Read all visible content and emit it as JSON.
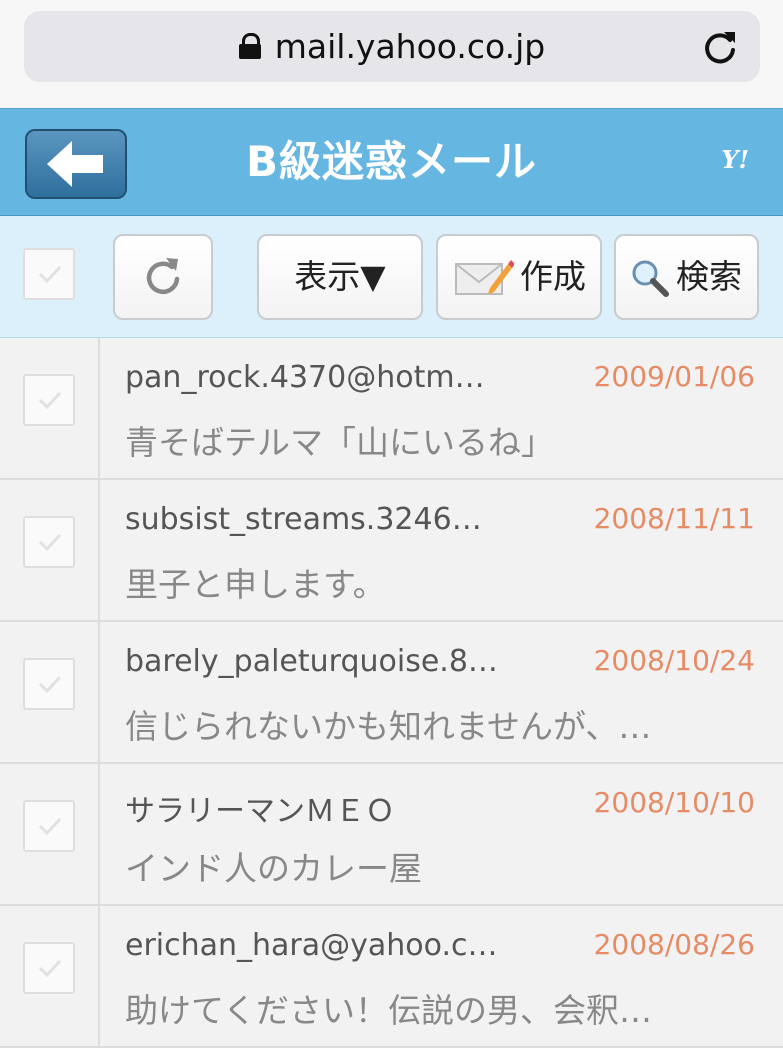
{
  "browser": {
    "url": "mail.yahoo.co.jp"
  },
  "header": {
    "title": "B級迷惑メール",
    "logo": "Y!"
  },
  "toolbar": {
    "display_label": "表示▼",
    "compose_label": "作成",
    "search_label": "検索"
  },
  "colors": {
    "header_bg": "#66b6e2",
    "toolbar_bg": "#dcf0fb",
    "date_color": "#e58c66"
  },
  "messages": [
    {
      "sender": "pan_rock.4370@hotm…",
      "date": "2009/01/06",
      "subject": "青そばテルマ「山にいるね」"
    },
    {
      "sender": "subsist_streams.3246…",
      "date": "2008/11/11",
      "subject": "里子と申します。"
    },
    {
      "sender": "barely_paleturquoise.8…",
      "date": "2008/10/24",
      "subject": "信じられないかも知れませんが、…"
    },
    {
      "sender": "サラリーマンＭＥＯ",
      "date": "2008/10/10",
      "subject": "インド人のカレー屋"
    },
    {
      "sender": "erichan_hara@yahoo.c…",
      "date": "2008/08/26",
      "subject": "助けてください！伝説の男、会釈…"
    }
  ]
}
